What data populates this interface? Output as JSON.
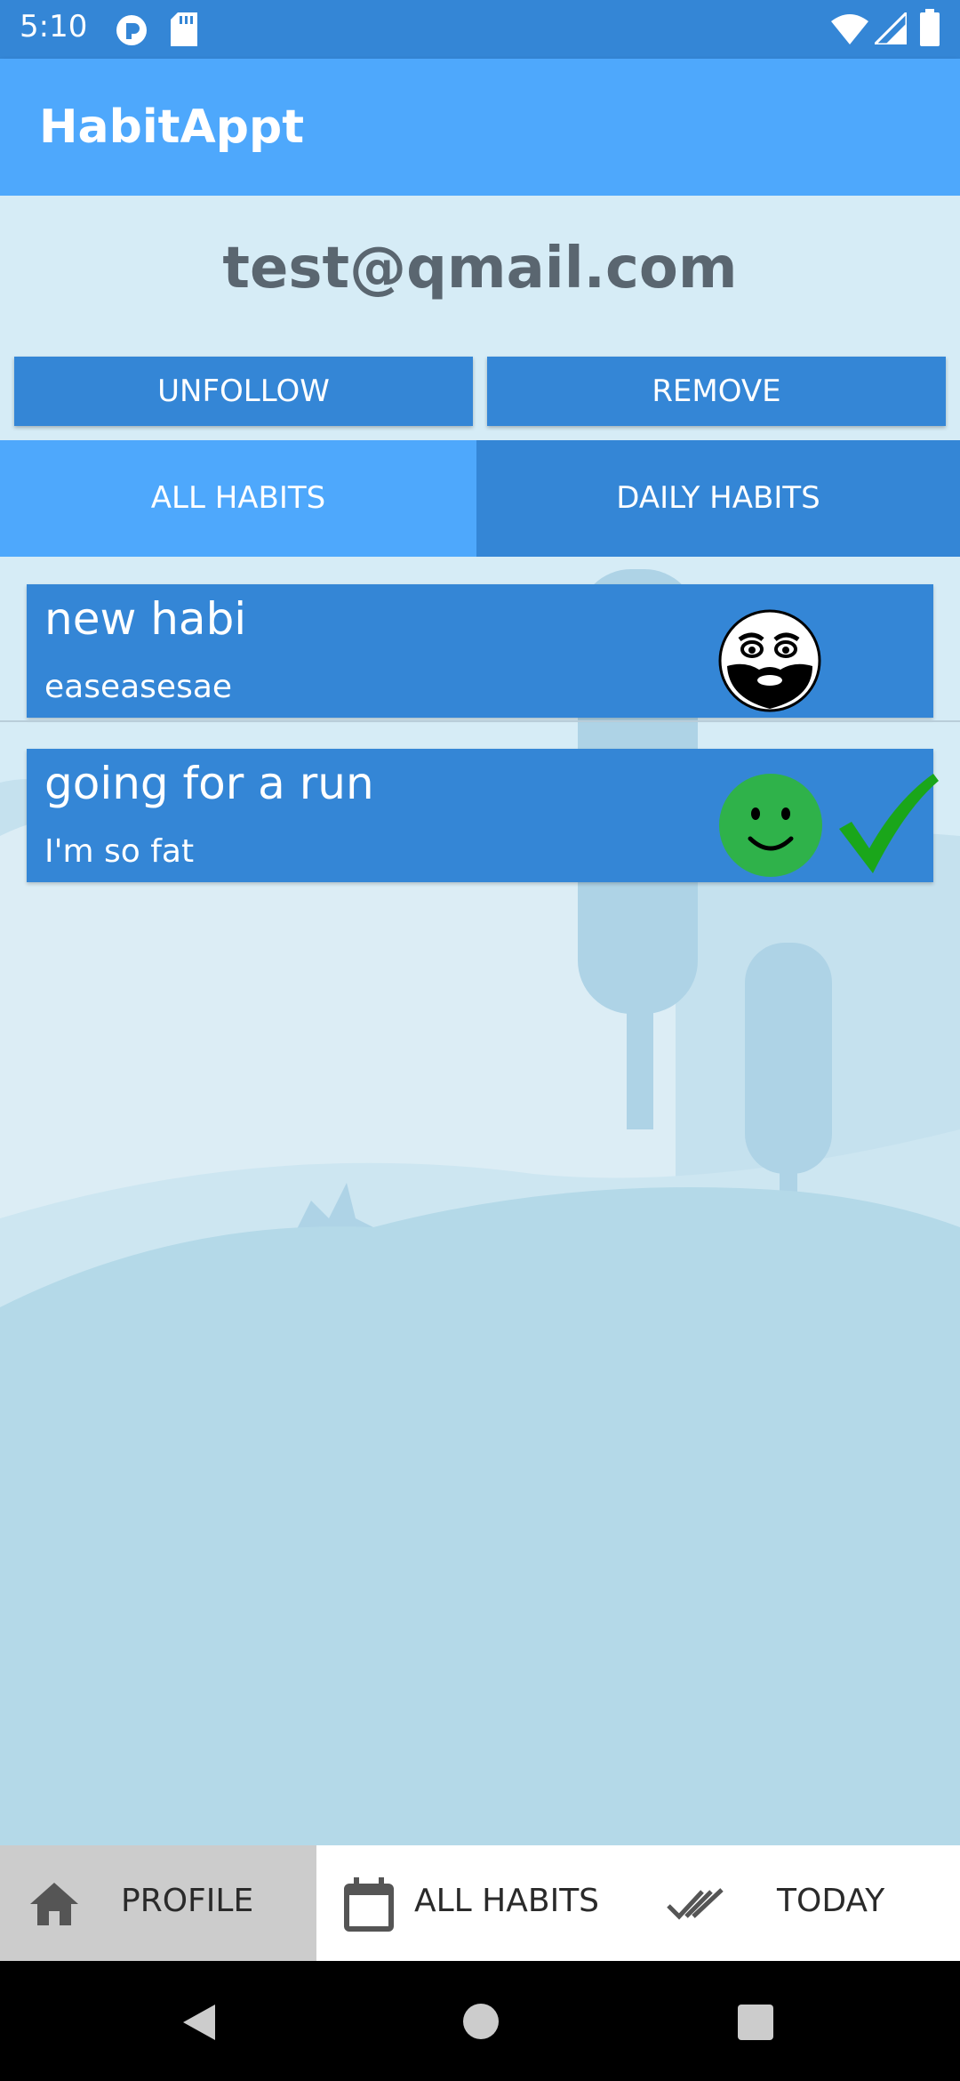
{
  "status_bar": {
    "time": "5:10",
    "icons": [
      "data-saver-icon",
      "sd-card-icon",
      "wifi-icon",
      "signal-icon",
      "battery-icon"
    ]
  },
  "app_bar": {
    "title": "HabitAppt"
  },
  "profile": {
    "email": "test@qmail.com"
  },
  "actions": {
    "unfollow_label": "UNFOLLOW",
    "remove_label": "REMOVE"
  },
  "tabs": [
    {
      "label": "ALL HABITS",
      "selected": true
    },
    {
      "label": "DAILY HABITS",
      "selected": false
    }
  ],
  "habits": [
    {
      "name": "new habi",
      "description": "easeasesae",
      "mood_icon": "meme-face-icon",
      "completed": false
    },
    {
      "name": "going for a run",
      "description": "I'm so fat",
      "mood_icon": "smiley-face-icon",
      "completed": true
    }
  ],
  "bottom_nav": [
    {
      "label": "PROFILE",
      "icon": "home-icon",
      "active": true
    },
    {
      "label": "ALL HABITS",
      "icon": "calendar-icon",
      "active": false
    },
    {
      "label": "TODAY",
      "icon": "double-check-icon",
      "active": false
    }
  ],
  "colors": {
    "primary": "#4ea8fc",
    "primary_dark": "#3486d6",
    "background": "#d6ecf6",
    "complete_green": "#1aa61a"
  }
}
